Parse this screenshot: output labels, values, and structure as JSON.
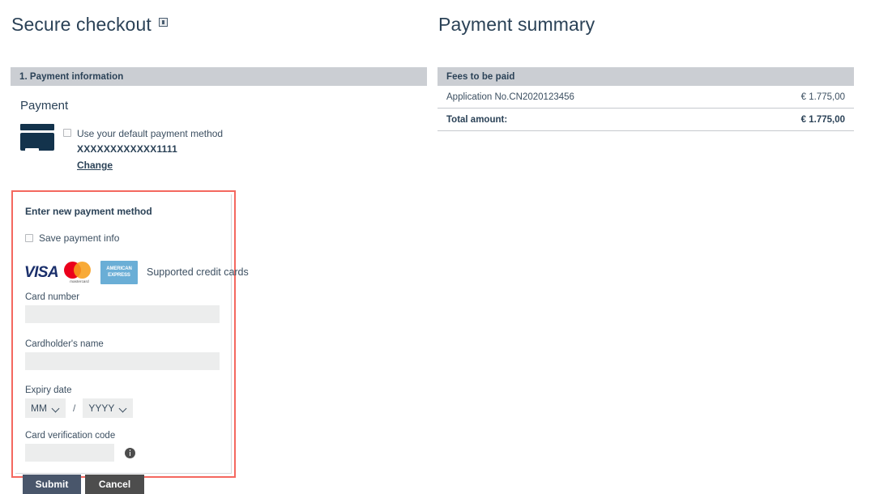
{
  "left": {
    "title": "Secure checkout",
    "title_icon": "info-square-icon",
    "section_bar_label": "1. Payment information",
    "payment_label": "Payment",
    "card_icon": "credit-card-icon",
    "default_method": {
      "checkbox_label": "Use your default payment method",
      "masked_card": "XXXXXXXXXXXX1111",
      "change_link": "Change"
    },
    "new_payment": {
      "heading": "Enter new payment method",
      "save_info_label": "Save payment info",
      "brands": {
        "visa": "VISA",
        "mastercard_word": "mastercard",
        "amex_line1": "AMERICAN",
        "amex_line2": "EXPRESS",
        "caption": "Supported credit cards"
      },
      "fields": {
        "card_number_label": "Card number",
        "card_number_value": "",
        "card_number_placeholder": "",
        "cardholder_label": "Cardholder's name",
        "cardholder_value": "",
        "cardholder_placeholder": "",
        "expiry_label": "Expiry date",
        "expiry_month": "MM",
        "expiry_separator": "/",
        "expiry_year": "YYYY",
        "cvc_label": "Card verification code",
        "cvc_value": "",
        "cvc_placeholder": "",
        "cvc_info_icon": "info-circle-icon"
      }
    },
    "buttons": {
      "submit": "Submit",
      "cancel": "Cancel"
    }
  },
  "right": {
    "title": "Payment summary",
    "section_bar_label": "Fees to be paid",
    "rows": [
      {
        "description": "Application No.CN2020123456",
        "amount": "€ 1.775,00"
      }
    ],
    "total": {
      "description": "Total amount:",
      "amount": "€ 1.775,00"
    }
  },
  "colors": {
    "heading_text": "#2b4257",
    "bar_background": "#cbced3",
    "input_background": "#eceded",
    "highlight_border": "#f4685f",
    "submit_button": "#49566b",
    "cancel_button": "#4d4d4d",
    "card_icon": "#13334c",
    "visa": "#1a2f6b",
    "mastercard_red": "#eb001b",
    "mastercard_orange": "#f79e1b",
    "amex_blue": "#6aaed6"
  }
}
